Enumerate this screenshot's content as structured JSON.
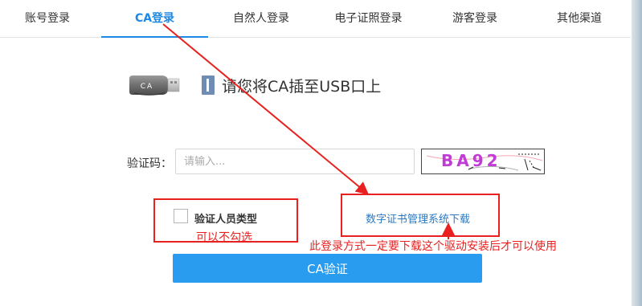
{
  "tabs": [
    {
      "label": "账号登录",
      "active": false
    },
    {
      "label": "CA登录",
      "active": true
    },
    {
      "label": "自然人登录",
      "active": false
    },
    {
      "label": "电子证照登录",
      "active": false
    },
    {
      "label": "游客登录",
      "active": false
    },
    {
      "label": "其他渠道",
      "active": false
    }
  ],
  "usb": {
    "icon_text": "CA",
    "message": "请您将CA插至USB口上"
  },
  "captcha": {
    "label": "验证码：",
    "placeholder": "请输入...",
    "image_text": "BA92"
  },
  "checkbox": {
    "label": "验证人员类型",
    "checked": false
  },
  "download": {
    "label": "数字证书管理系统下载"
  },
  "submit": {
    "label": "CA验证"
  },
  "annotations": {
    "checkbox_note": "可以不勾选",
    "download_note": "此登录方式一定要下载这个驱动安装后才可以使用",
    "color": "#e8201f"
  },
  "colors": {
    "accent": "#1e88e5",
    "button": "#2a9cf0",
    "link": "#2b79c2"
  }
}
